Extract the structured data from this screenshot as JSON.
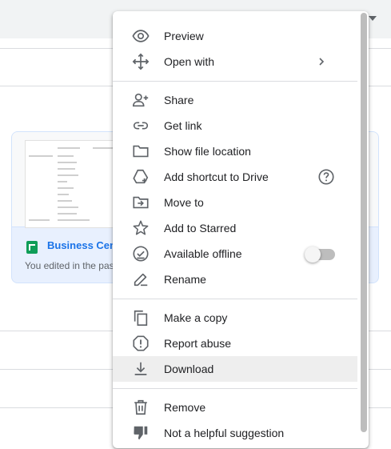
{
  "background": {
    "card": {
      "title": "Business Centr",
      "subtitle": "You edited in the pas"
    }
  },
  "menu": {
    "items": [
      {
        "label": "Preview",
        "icon": "eye-icon"
      },
      {
        "label": "Open with",
        "icon": "open-with-icon",
        "has_submenu": true
      },
      {
        "label": "Share",
        "icon": "person-add-icon"
      },
      {
        "label": "Get link",
        "icon": "link-icon"
      },
      {
        "label": "Show file location",
        "icon": "folder-icon"
      },
      {
        "label": "Add shortcut to Drive",
        "icon": "drive-shortcut-icon",
        "has_help": true
      },
      {
        "label": "Move to",
        "icon": "move-to-folder-icon"
      },
      {
        "label": "Add to Starred",
        "icon": "star-icon"
      },
      {
        "label": "Available offline",
        "icon": "offline-check-icon",
        "toggle": false
      },
      {
        "label": "Rename",
        "icon": "pencil-icon"
      },
      {
        "label": "Make a copy",
        "icon": "copy-icon"
      },
      {
        "label": "Report abuse",
        "icon": "report-icon"
      },
      {
        "label": "Download",
        "icon": "download-icon",
        "highlighted": true
      },
      {
        "label": "Remove",
        "icon": "trash-icon"
      },
      {
        "label": "Not a helpful suggestion",
        "icon": "thumbs-down-icon"
      }
    ]
  },
  "colors": {
    "accent": "#1a73e8",
    "sheets_green": "#0f9d58",
    "icon_gray": "#5f6368",
    "highlight": "#eeeeee"
  }
}
